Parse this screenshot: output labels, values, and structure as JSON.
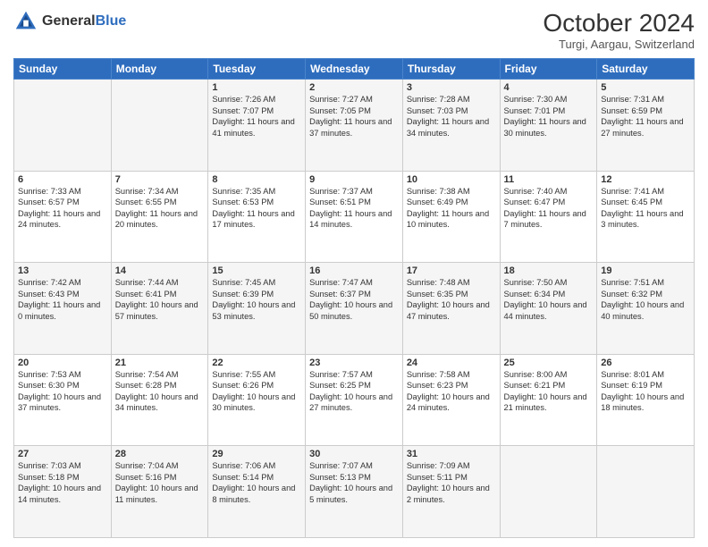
{
  "logo": {
    "text1": "General",
    "text2": "Blue"
  },
  "title": "October 2024",
  "location": "Turgi, Aargau, Switzerland",
  "days_of_week": [
    "Sunday",
    "Monday",
    "Tuesday",
    "Wednesday",
    "Thursday",
    "Friday",
    "Saturday"
  ],
  "weeks": [
    [
      {
        "day": "",
        "sunrise": "",
        "sunset": "",
        "daylight": ""
      },
      {
        "day": "",
        "sunrise": "",
        "sunset": "",
        "daylight": ""
      },
      {
        "day": "1",
        "sunrise": "Sunrise: 7:26 AM",
        "sunset": "Sunset: 7:07 PM",
        "daylight": "Daylight: 11 hours and 41 minutes."
      },
      {
        "day": "2",
        "sunrise": "Sunrise: 7:27 AM",
        "sunset": "Sunset: 7:05 PM",
        "daylight": "Daylight: 11 hours and 37 minutes."
      },
      {
        "day": "3",
        "sunrise": "Sunrise: 7:28 AM",
        "sunset": "Sunset: 7:03 PM",
        "daylight": "Daylight: 11 hours and 34 minutes."
      },
      {
        "day": "4",
        "sunrise": "Sunrise: 7:30 AM",
        "sunset": "Sunset: 7:01 PM",
        "daylight": "Daylight: 11 hours and 30 minutes."
      },
      {
        "day": "5",
        "sunrise": "Sunrise: 7:31 AM",
        "sunset": "Sunset: 6:59 PM",
        "daylight": "Daylight: 11 hours and 27 minutes."
      }
    ],
    [
      {
        "day": "6",
        "sunrise": "Sunrise: 7:33 AM",
        "sunset": "Sunset: 6:57 PM",
        "daylight": "Daylight: 11 hours and 24 minutes."
      },
      {
        "day": "7",
        "sunrise": "Sunrise: 7:34 AM",
        "sunset": "Sunset: 6:55 PM",
        "daylight": "Daylight: 11 hours and 20 minutes."
      },
      {
        "day": "8",
        "sunrise": "Sunrise: 7:35 AM",
        "sunset": "Sunset: 6:53 PM",
        "daylight": "Daylight: 11 hours and 17 minutes."
      },
      {
        "day": "9",
        "sunrise": "Sunrise: 7:37 AM",
        "sunset": "Sunset: 6:51 PM",
        "daylight": "Daylight: 11 hours and 14 minutes."
      },
      {
        "day": "10",
        "sunrise": "Sunrise: 7:38 AM",
        "sunset": "Sunset: 6:49 PM",
        "daylight": "Daylight: 11 hours and 10 minutes."
      },
      {
        "day": "11",
        "sunrise": "Sunrise: 7:40 AM",
        "sunset": "Sunset: 6:47 PM",
        "daylight": "Daylight: 11 hours and 7 minutes."
      },
      {
        "day": "12",
        "sunrise": "Sunrise: 7:41 AM",
        "sunset": "Sunset: 6:45 PM",
        "daylight": "Daylight: 11 hours and 3 minutes."
      }
    ],
    [
      {
        "day": "13",
        "sunrise": "Sunrise: 7:42 AM",
        "sunset": "Sunset: 6:43 PM",
        "daylight": "Daylight: 11 hours and 0 minutes."
      },
      {
        "day": "14",
        "sunrise": "Sunrise: 7:44 AM",
        "sunset": "Sunset: 6:41 PM",
        "daylight": "Daylight: 10 hours and 57 minutes."
      },
      {
        "day": "15",
        "sunrise": "Sunrise: 7:45 AM",
        "sunset": "Sunset: 6:39 PM",
        "daylight": "Daylight: 10 hours and 53 minutes."
      },
      {
        "day": "16",
        "sunrise": "Sunrise: 7:47 AM",
        "sunset": "Sunset: 6:37 PM",
        "daylight": "Daylight: 10 hours and 50 minutes."
      },
      {
        "day": "17",
        "sunrise": "Sunrise: 7:48 AM",
        "sunset": "Sunset: 6:35 PM",
        "daylight": "Daylight: 10 hours and 47 minutes."
      },
      {
        "day": "18",
        "sunrise": "Sunrise: 7:50 AM",
        "sunset": "Sunset: 6:34 PM",
        "daylight": "Daylight: 10 hours and 44 minutes."
      },
      {
        "day": "19",
        "sunrise": "Sunrise: 7:51 AM",
        "sunset": "Sunset: 6:32 PM",
        "daylight": "Daylight: 10 hours and 40 minutes."
      }
    ],
    [
      {
        "day": "20",
        "sunrise": "Sunrise: 7:53 AM",
        "sunset": "Sunset: 6:30 PM",
        "daylight": "Daylight: 10 hours and 37 minutes."
      },
      {
        "day": "21",
        "sunrise": "Sunrise: 7:54 AM",
        "sunset": "Sunset: 6:28 PM",
        "daylight": "Daylight: 10 hours and 34 minutes."
      },
      {
        "day": "22",
        "sunrise": "Sunrise: 7:55 AM",
        "sunset": "Sunset: 6:26 PM",
        "daylight": "Daylight: 10 hours and 30 minutes."
      },
      {
        "day": "23",
        "sunrise": "Sunrise: 7:57 AM",
        "sunset": "Sunset: 6:25 PM",
        "daylight": "Daylight: 10 hours and 27 minutes."
      },
      {
        "day": "24",
        "sunrise": "Sunrise: 7:58 AM",
        "sunset": "Sunset: 6:23 PM",
        "daylight": "Daylight: 10 hours and 24 minutes."
      },
      {
        "day": "25",
        "sunrise": "Sunrise: 8:00 AM",
        "sunset": "Sunset: 6:21 PM",
        "daylight": "Daylight: 10 hours and 21 minutes."
      },
      {
        "day": "26",
        "sunrise": "Sunrise: 8:01 AM",
        "sunset": "Sunset: 6:19 PM",
        "daylight": "Daylight: 10 hours and 18 minutes."
      }
    ],
    [
      {
        "day": "27",
        "sunrise": "Sunrise: 7:03 AM",
        "sunset": "Sunset: 5:18 PM",
        "daylight": "Daylight: 10 hours and 14 minutes."
      },
      {
        "day": "28",
        "sunrise": "Sunrise: 7:04 AM",
        "sunset": "Sunset: 5:16 PM",
        "daylight": "Daylight: 10 hours and 11 minutes."
      },
      {
        "day": "29",
        "sunrise": "Sunrise: 7:06 AM",
        "sunset": "Sunset: 5:14 PM",
        "daylight": "Daylight: 10 hours and 8 minutes."
      },
      {
        "day": "30",
        "sunrise": "Sunrise: 7:07 AM",
        "sunset": "Sunset: 5:13 PM",
        "daylight": "Daylight: 10 hours and 5 minutes."
      },
      {
        "day": "31",
        "sunrise": "Sunrise: 7:09 AM",
        "sunset": "Sunset: 5:11 PM",
        "daylight": "Daylight: 10 hours and 2 minutes."
      },
      {
        "day": "",
        "sunrise": "",
        "sunset": "",
        "daylight": ""
      },
      {
        "day": "",
        "sunrise": "",
        "sunset": "",
        "daylight": ""
      }
    ]
  ]
}
